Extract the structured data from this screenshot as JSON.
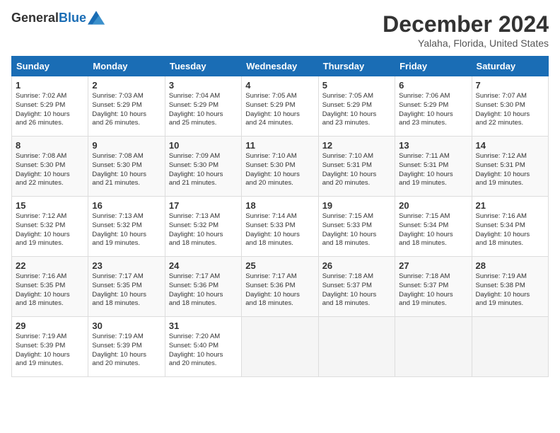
{
  "logo": {
    "line1": "General",
    "line2": "Blue"
  },
  "title": "December 2024",
  "location": "Yalaha, Florida, United States",
  "weekdays": [
    "Sunday",
    "Monday",
    "Tuesday",
    "Wednesday",
    "Thursday",
    "Friday",
    "Saturday"
  ],
  "weeks": [
    [
      {
        "day": "1",
        "info": "Sunrise: 7:02 AM\nSunset: 5:29 PM\nDaylight: 10 hours\nand 26 minutes."
      },
      {
        "day": "2",
        "info": "Sunrise: 7:03 AM\nSunset: 5:29 PM\nDaylight: 10 hours\nand 26 minutes."
      },
      {
        "day": "3",
        "info": "Sunrise: 7:04 AM\nSunset: 5:29 PM\nDaylight: 10 hours\nand 25 minutes."
      },
      {
        "day": "4",
        "info": "Sunrise: 7:05 AM\nSunset: 5:29 PM\nDaylight: 10 hours\nand 24 minutes."
      },
      {
        "day": "5",
        "info": "Sunrise: 7:05 AM\nSunset: 5:29 PM\nDaylight: 10 hours\nand 23 minutes."
      },
      {
        "day": "6",
        "info": "Sunrise: 7:06 AM\nSunset: 5:29 PM\nDaylight: 10 hours\nand 23 minutes."
      },
      {
        "day": "7",
        "info": "Sunrise: 7:07 AM\nSunset: 5:30 PM\nDaylight: 10 hours\nand 22 minutes."
      }
    ],
    [
      {
        "day": "8",
        "info": "Sunrise: 7:08 AM\nSunset: 5:30 PM\nDaylight: 10 hours\nand 22 minutes."
      },
      {
        "day": "9",
        "info": "Sunrise: 7:08 AM\nSunset: 5:30 PM\nDaylight: 10 hours\nand 21 minutes."
      },
      {
        "day": "10",
        "info": "Sunrise: 7:09 AM\nSunset: 5:30 PM\nDaylight: 10 hours\nand 21 minutes."
      },
      {
        "day": "11",
        "info": "Sunrise: 7:10 AM\nSunset: 5:30 PM\nDaylight: 10 hours\nand 20 minutes."
      },
      {
        "day": "12",
        "info": "Sunrise: 7:10 AM\nSunset: 5:31 PM\nDaylight: 10 hours\nand 20 minutes."
      },
      {
        "day": "13",
        "info": "Sunrise: 7:11 AM\nSunset: 5:31 PM\nDaylight: 10 hours\nand 19 minutes."
      },
      {
        "day": "14",
        "info": "Sunrise: 7:12 AM\nSunset: 5:31 PM\nDaylight: 10 hours\nand 19 minutes."
      }
    ],
    [
      {
        "day": "15",
        "info": "Sunrise: 7:12 AM\nSunset: 5:32 PM\nDaylight: 10 hours\nand 19 minutes."
      },
      {
        "day": "16",
        "info": "Sunrise: 7:13 AM\nSunset: 5:32 PM\nDaylight: 10 hours\nand 19 minutes."
      },
      {
        "day": "17",
        "info": "Sunrise: 7:13 AM\nSunset: 5:32 PM\nDaylight: 10 hours\nand 18 minutes."
      },
      {
        "day": "18",
        "info": "Sunrise: 7:14 AM\nSunset: 5:33 PM\nDaylight: 10 hours\nand 18 minutes."
      },
      {
        "day": "19",
        "info": "Sunrise: 7:15 AM\nSunset: 5:33 PM\nDaylight: 10 hours\nand 18 minutes."
      },
      {
        "day": "20",
        "info": "Sunrise: 7:15 AM\nSunset: 5:34 PM\nDaylight: 10 hours\nand 18 minutes."
      },
      {
        "day": "21",
        "info": "Sunrise: 7:16 AM\nSunset: 5:34 PM\nDaylight: 10 hours\nand 18 minutes."
      }
    ],
    [
      {
        "day": "22",
        "info": "Sunrise: 7:16 AM\nSunset: 5:35 PM\nDaylight: 10 hours\nand 18 minutes."
      },
      {
        "day": "23",
        "info": "Sunrise: 7:17 AM\nSunset: 5:35 PM\nDaylight: 10 hours\nand 18 minutes."
      },
      {
        "day": "24",
        "info": "Sunrise: 7:17 AM\nSunset: 5:36 PM\nDaylight: 10 hours\nand 18 minutes."
      },
      {
        "day": "25",
        "info": "Sunrise: 7:17 AM\nSunset: 5:36 PM\nDaylight: 10 hours\nand 18 minutes."
      },
      {
        "day": "26",
        "info": "Sunrise: 7:18 AM\nSunset: 5:37 PM\nDaylight: 10 hours\nand 18 minutes."
      },
      {
        "day": "27",
        "info": "Sunrise: 7:18 AM\nSunset: 5:37 PM\nDaylight: 10 hours\nand 19 minutes."
      },
      {
        "day": "28",
        "info": "Sunrise: 7:19 AM\nSunset: 5:38 PM\nDaylight: 10 hours\nand 19 minutes."
      }
    ],
    [
      {
        "day": "29",
        "info": "Sunrise: 7:19 AM\nSunset: 5:39 PM\nDaylight: 10 hours\nand 19 minutes."
      },
      {
        "day": "30",
        "info": "Sunrise: 7:19 AM\nSunset: 5:39 PM\nDaylight: 10 hours\nand 20 minutes."
      },
      {
        "day": "31",
        "info": "Sunrise: 7:20 AM\nSunset: 5:40 PM\nDaylight: 10 hours\nand 20 minutes."
      },
      {
        "day": "",
        "info": ""
      },
      {
        "day": "",
        "info": ""
      },
      {
        "day": "",
        "info": ""
      },
      {
        "day": "",
        "info": ""
      }
    ]
  ]
}
